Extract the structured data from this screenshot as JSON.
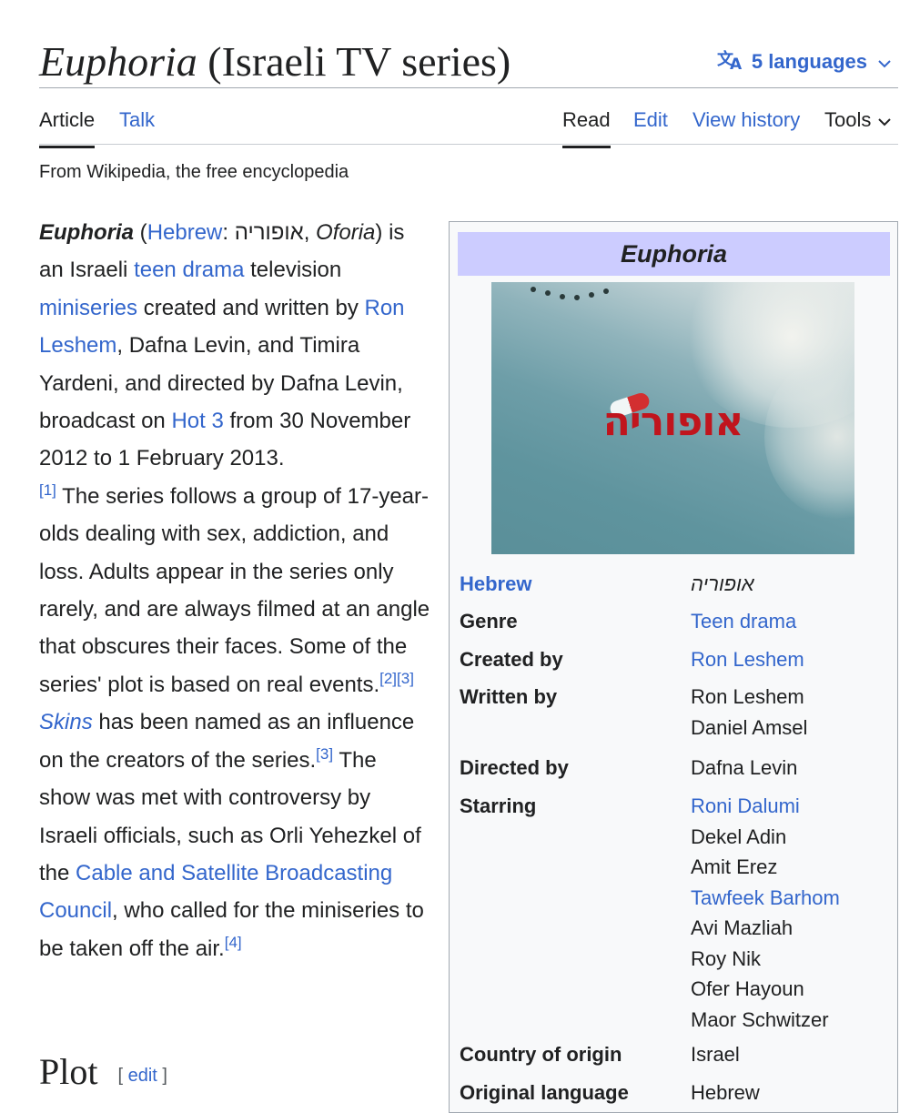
{
  "header": {
    "title_italic": "Euphoria",
    "title_rest": "(Israeli TV series)",
    "languages_label": "5 languages"
  },
  "tabs": {
    "article": "Article",
    "talk": "Talk",
    "read": "Read",
    "edit": "Edit",
    "view_history": "View history",
    "tools": "Tools"
  },
  "tagline": "From Wikipedia, the free encyclopedia",
  "lead": {
    "bold_title": "Euphoria",
    "hebrew_link": "Hebrew",
    "hebrew_text": ": אופוריה, ",
    "oforia": "Oforia",
    "t1": ") is an Israeli ",
    "teen_drama": "teen drama",
    "t2": " television ",
    "miniseries": "miniseries",
    "t3": " created and written by ",
    "ron_leshem": "Ron Leshem",
    "t4": ", Dafna Levin, and Timira Yardeni, and directed by Dafna Levin, broadcast on ",
    "hot3": "Hot 3",
    "t5": " from 30 November 2012 to 1 February 2013.",
    "ref1": "[1]",
    "t6": " The series follows a group of 17-year-olds dealing with sex, addiction, and loss. Adults appear in the series only rarely, and are always filmed at an angle that obscures their faces. Some of the series' plot is based on real events.",
    "ref2": "[2]",
    "ref3a": "[3]",
    "skins": "Skins",
    "t7": " has been named as an influence on the creators of the series.",
    "ref3b": "[3]",
    "t8": " The show was met with controversy by Israeli officials, such as Orli Yehezkel of the ",
    "council": "Cable and Satellite Broadcasting Council",
    "t9": ", who called for the miniseries to be taken off the air.",
    "ref4": "[4]"
  },
  "infobox": {
    "title": "Euphoria",
    "image_logo_text": "אופוריה",
    "rows": [
      {
        "label": "Hebrew",
        "values": [
          "אופוריה"
        ]
      },
      {
        "label": "Genre",
        "values": [
          "Teen drama"
        ]
      },
      {
        "label": "Created by",
        "values": [
          "Ron Leshem"
        ]
      },
      {
        "label": "Written by",
        "values": [
          "Ron Leshem",
          "Daniel Amsel"
        ]
      },
      {
        "label": "Directed by",
        "values": [
          "Dafna Levin"
        ]
      },
      {
        "label": "Starring",
        "values": [
          "Roni Dalumi",
          "Dekel Adin",
          "Amit Erez",
          "Tawfeek Barhom",
          "Avi Mazliah",
          "Roy Nik",
          "Ofer Hayoun",
          "Maor Schwitzer"
        ]
      },
      {
        "label": "Country of origin",
        "values": [
          "Israel"
        ]
      },
      {
        "label": "Original language",
        "values": [
          "Hebrew"
        ]
      }
    ]
  },
  "section": {
    "heading": "Plot",
    "edit_open": "[ ",
    "edit_label": "edit",
    "edit_close": " ]"
  },
  "colors": {
    "link": "#3366cc",
    "infobox_title_bg": "#ccccff",
    "logo_red": "#c0151d"
  }
}
